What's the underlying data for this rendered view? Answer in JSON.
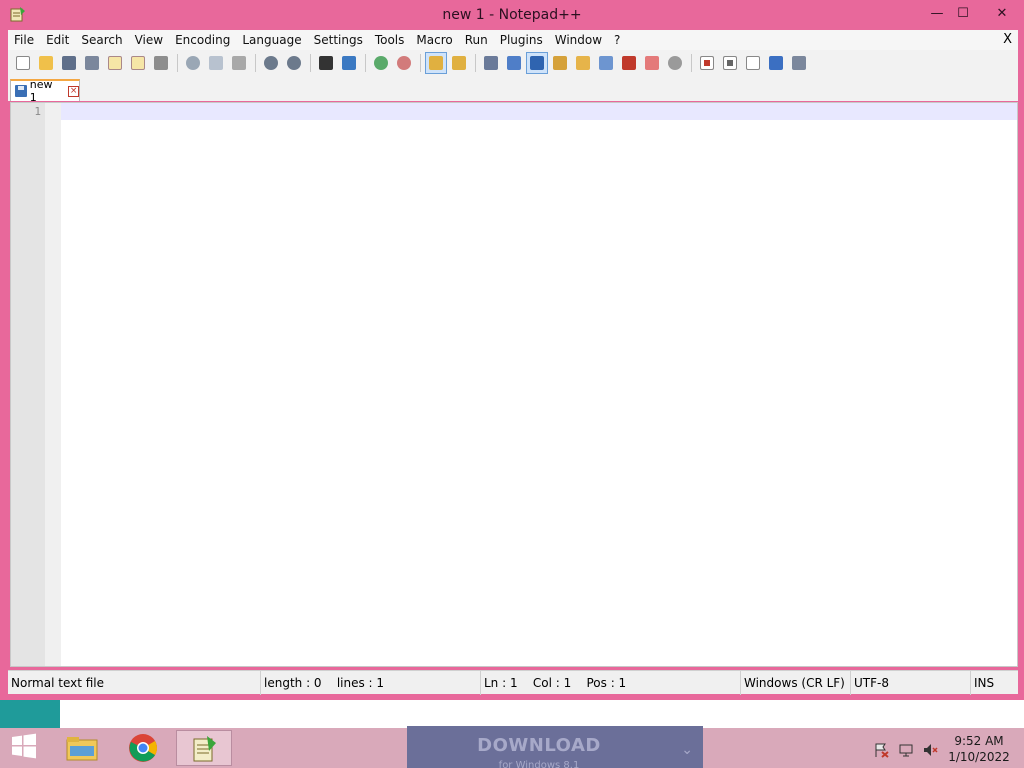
{
  "window": {
    "title": "new 1 - Notepad++",
    "minimize_glyph": "—",
    "maximize_glyph": "☐",
    "close_glyph": "✕"
  },
  "menu": {
    "items": [
      "File",
      "Edit",
      "Search",
      "View",
      "Encoding",
      "Language",
      "Settings",
      "Tools",
      "Macro",
      "Run",
      "Plugins",
      "Window",
      "?"
    ],
    "close_doc": "X"
  },
  "tabs": [
    {
      "label": "new 1",
      "close": "×"
    }
  ],
  "editor": {
    "line_numbers": [
      "1"
    ],
    "content": ""
  },
  "status": {
    "file_type": "Normal text file",
    "length_lines": "length : 0    lines : 1",
    "cursor": "Ln : 1    Col : 1    Pos : 1",
    "eol": "Windows (CR LF)",
    "encoding": "UTF-8",
    "mode": "INS"
  },
  "taskbar": {
    "download_title": "DOWNLOAD",
    "download_sub": "for Windows 8.1",
    "download_chevron": "⌄",
    "clock_time": "9:52 AM",
    "clock_date": "1/10/2022"
  },
  "colors": {
    "window_frame": "#e8689b",
    "desktop": "#1f9b9a",
    "taskbar": "#d9a9ba",
    "tab_accent": "#f4a742",
    "download_banner": "#6b6f99"
  }
}
